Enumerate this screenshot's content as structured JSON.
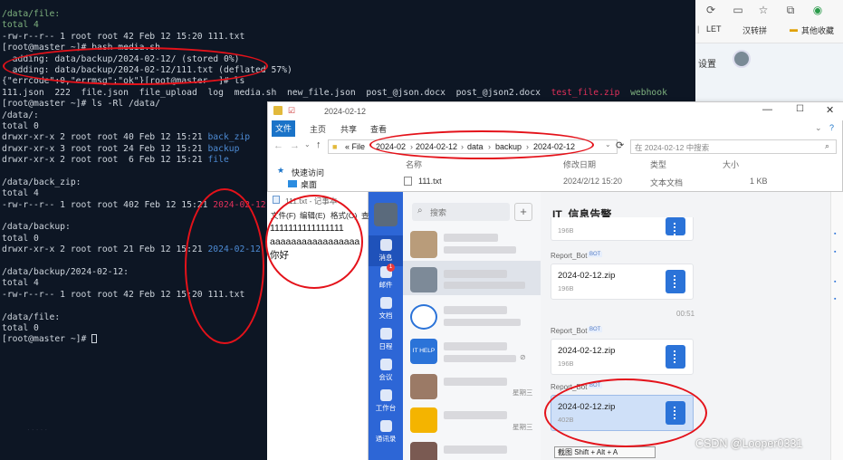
{
  "terminal": {
    "lines": [
      [
        {
          "t": "/data/file:",
          "c": "c-grn"
        }
      ],
      [
        {
          "t": "total 4",
          "c": "c-grn"
        }
      ],
      [
        {
          "t": "-rw-r--r-- 1 root root 42 Feb 12 15:20 111.txt",
          "c": ""
        }
      ],
      [
        {
          "t": "[root@master ~]# bash media.sh",
          "c": ""
        }
      ],
      [
        {
          "t": "  adding: data/backup/2024-02-12/ (stored 0%)",
          "c": ""
        }
      ],
      [
        {
          "t": "  adding: data/backup/2024-02-12/111.txt (deflated 57%)",
          "c": ""
        }
      ],
      [
        {
          "t": "{\"errcode\":0,\"errmsg\":\"ok\"}[root@master ~]# ls",
          "c": ""
        }
      ],
      [
        {
          "t": "111.json  222  file.json  file_upload  log  media.sh  new_file.json  post_@json.docx  post_@json2.docx  ",
          "c": ""
        },
        {
          "t": "test_file.zip",
          "c": "c-zip"
        },
        {
          "t": "  webhook",
          "c": "c-grn"
        }
      ],
      [
        {
          "t": "[root@master ~]# ls -Rl /data/",
          "c": ""
        }
      ],
      [
        {
          "t": "/data/:",
          "c": ""
        }
      ],
      [
        {
          "t": "total 0",
          "c": ""
        }
      ],
      [
        {
          "t": "drwxr-xr-x 2 root root 40 Feb 12 15:21 ",
          "c": ""
        },
        {
          "t": "back_zip",
          "c": "c-dir"
        }
      ],
      [
        {
          "t": "drwxr-xr-x 3 root root 24 Feb 12 15:21 ",
          "c": ""
        },
        {
          "t": "backup",
          "c": "c-dir"
        }
      ],
      [
        {
          "t": "drwxr-xr-x 2 root root  6 Feb 12 15:21 ",
          "c": ""
        },
        {
          "t": "file",
          "c": "c-dir"
        }
      ],
      [
        {
          "t": "",
          "c": ""
        }
      ],
      [
        {
          "t": "/data/back_zip:",
          "c": ""
        }
      ],
      [
        {
          "t": "total 4",
          "c": ""
        }
      ],
      [
        {
          "t": "-rw-r--r-- 1 root root 402 Feb 12 15:21 ",
          "c": ""
        },
        {
          "t": "2024-02-12.zip",
          "c": "c-zip"
        }
      ],
      [
        {
          "t": "",
          "c": ""
        }
      ],
      [
        {
          "t": "/data/backup:",
          "c": ""
        }
      ],
      [
        {
          "t": "total 0",
          "c": ""
        }
      ],
      [
        {
          "t": "drwxr-xr-x 2 root root 21 Feb 12 15:21 ",
          "c": ""
        },
        {
          "t": "2024-02-12",
          "c": "c-dir"
        }
      ],
      [
        {
          "t": "",
          "c": ""
        }
      ],
      [
        {
          "t": "/data/backup/2024-02-12:",
          "c": ""
        }
      ],
      [
        {
          "t": "total 4",
          "c": ""
        }
      ],
      [
        {
          "t": "-rw-r--r-- 1 root root 42 Feb 12 15:20 111.txt",
          "c": ""
        }
      ],
      [
        {
          "t": "",
          "c": ""
        }
      ],
      [
        {
          "t": "/data/file:",
          "c": ""
        }
      ],
      [
        {
          "t": "total 0",
          "c": ""
        }
      ],
      [
        {
          "t": "[root@master ~]# ",
          "c": ""
        }
      ]
    ]
  },
  "browser": {
    "bookmark_let": "LET",
    "bookmark_hanzhuanpin": "汉转拼",
    "bookmark_other": "其他收藏",
    "settings": "设置"
  },
  "explorer": {
    "title": "2024-02-12",
    "tabs": [
      "文件",
      "主页",
      "共享",
      "查看"
    ],
    "breadcrumb": [
      "« File",
      "2024-02",
      "2024-02-12",
      "data",
      "backup",
      "2024-02-12"
    ],
    "search_placeholder": "在 2024-02-12 中搜索",
    "sidebar": [
      "快速访问",
      "桌面"
    ],
    "columns": [
      "名称",
      "修改日期",
      "类型",
      "大小"
    ],
    "file": {
      "name": "111.txt",
      "modified": "2024/2/12 15:20",
      "type": "文本文档",
      "size": "1 KB"
    }
  },
  "notepad": {
    "title": "111.txt - 记事本",
    "menu": [
      "文件(F)",
      "编辑(E)",
      "格式(O)",
      "查"
    ],
    "lines": [
      "1111111111111111",
      "aaaaaaaaaaaaaaaaa",
      "你好"
    ]
  },
  "wecom": {
    "nav": [
      {
        "label": "消息",
        "icon": "message-icon"
      },
      {
        "label": "邮件",
        "icon": "mail-icon",
        "badge": "1"
      },
      {
        "label": "文档",
        "icon": "doc-icon"
      },
      {
        "label": "日程",
        "icon": "calendar-icon"
      },
      {
        "label": "会议",
        "icon": "meeting-icon"
      },
      {
        "label": "工作台",
        "icon": "workbench-icon"
      },
      {
        "label": "通讯录",
        "icon": "contacts-icon"
      }
    ],
    "search_placeholder": "搜索",
    "list_labels": {
      "it_help": "IT HELP",
      "weekday": "星期三"
    },
    "chat_title": "IT_信息告警",
    "messages": [
      {
        "sender": "",
        "file": "",
        "size": "196B"
      },
      {
        "sender": "Report_Bot",
        "badge": "BOT",
        "file": "2024-02-12.zip",
        "size": "196B"
      },
      {
        "sender": "Report_Bot",
        "badge": "BOT",
        "file": "2024-02-12.zip",
        "size": "196B"
      },
      {
        "sender": "Report_Bot",
        "badge": "BOT",
        "file": "2024-02-12.zip",
        "size": "402B"
      }
    ],
    "time_divider": "00:51",
    "screenshot_hint": "截图 Shift + Alt + A"
  },
  "watermark": "CSDN @Looper0331",
  "colors": {
    "annotation": "#e4121a",
    "wecom_blue": "#2d66d6",
    "terminal_bg": "#0d1624"
  }
}
